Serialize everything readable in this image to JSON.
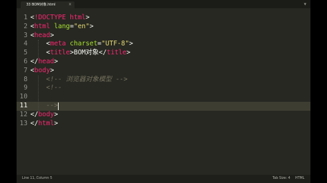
{
  "tab": {
    "filename": "33 BOM对象.html",
    "close_glyph": "×"
  },
  "tabbar": {
    "overflow_glyph": "▾"
  },
  "editor": {
    "active_line": 11,
    "lines": [
      {
        "n": "1",
        "tokens": [
          [
            "punc",
            "<"
          ],
          [
            "tag",
            "!DOCTYPE"
          ],
          [
            "txt",
            " "
          ],
          [
            "tag",
            "html"
          ],
          [
            "punc",
            ">"
          ]
        ]
      },
      {
        "n": "2",
        "tokens": [
          [
            "punc",
            "<"
          ],
          [
            "tag",
            "html"
          ],
          [
            "txt",
            " "
          ],
          [
            "attr",
            "lang"
          ],
          [
            "punc",
            "="
          ],
          [
            "str",
            "\"en\""
          ],
          [
            "punc",
            ">"
          ]
        ]
      },
      {
        "n": "3",
        "tokens": [
          [
            "punc",
            "<"
          ],
          [
            "tag",
            "head"
          ],
          [
            "punc",
            ">"
          ]
        ]
      },
      {
        "n": "4",
        "tokens": [
          [
            "txt",
            "    "
          ],
          [
            "punc",
            "<"
          ],
          [
            "tag",
            "meta"
          ],
          [
            "txt",
            " "
          ],
          [
            "attr",
            "charset"
          ],
          [
            "punc",
            "="
          ],
          [
            "str",
            "\"UTF-8\""
          ],
          [
            "punc",
            ">"
          ]
        ]
      },
      {
        "n": "5",
        "tokens": [
          [
            "txt",
            "    "
          ],
          [
            "punc",
            "<"
          ],
          [
            "tag",
            "title"
          ],
          [
            "punc",
            ">"
          ],
          [
            "txt",
            "BOM对象"
          ],
          [
            "punc",
            "</"
          ],
          [
            "tag",
            "title"
          ],
          [
            "punc",
            ">"
          ]
        ]
      },
      {
        "n": "6",
        "tokens": [
          [
            "punc",
            "</"
          ],
          [
            "tag",
            "head"
          ],
          [
            "punc",
            ">"
          ]
        ]
      },
      {
        "n": "7",
        "tokens": [
          [
            "punc",
            "<"
          ],
          [
            "tag",
            "body"
          ],
          [
            "punc",
            ">"
          ]
        ]
      },
      {
        "n": "8",
        "tokens": [
          [
            "txt",
            "    "
          ],
          [
            "cmt",
            "<!-- 浏览器对象模型 -->"
          ]
        ]
      },
      {
        "n": "9",
        "tokens": [
          [
            "txt",
            "    "
          ],
          [
            "cmt",
            "<!--"
          ]
        ]
      },
      {
        "n": "10",
        "tokens": []
      },
      {
        "n": "11",
        "tokens": [
          [
            "txt",
            "    "
          ],
          [
            "cmt",
            "-->"
          ]
        ]
      },
      {
        "n": "12",
        "tokens": [
          [
            "punc",
            "</"
          ],
          [
            "tag",
            "body"
          ],
          [
            "punc",
            ">"
          ]
        ]
      },
      {
        "n": "13",
        "tokens": [
          [
            "punc",
            "</"
          ],
          [
            "tag",
            "html"
          ],
          [
            "punc",
            ">"
          ]
        ]
      }
    ]
  },
  "statusbar": {
    "position": "Line 11, Column 5",
    "tab_size": "Tab Size: 4",
    "syntax": "HTML"
  }
}
